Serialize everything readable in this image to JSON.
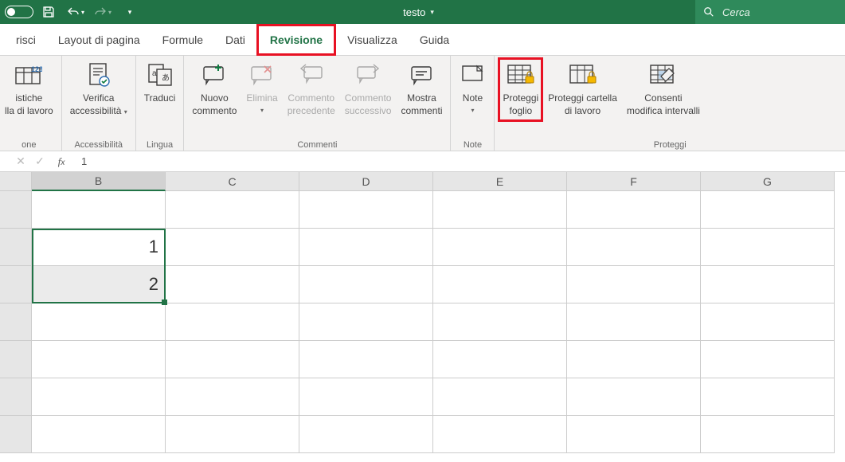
{
  "title": "testo",
  "search": {
    "placeholder": "Cerca"
  },
  "tabs": [
    "risci",
    "Layout di pagina",
    "Formule",
    "Dati",
    "Revisione",
    "Visualizza",
    "Guida"
  ],
  "active_tab": "Revisione",
  "highlighted_tab": "Revisione",
  "ribbon": {
    "groups": [
      {
        "label": "one",
        "items": [
          {
            "name": "statistics",
            "label1": "istiche",
            "label2": "lla di lavoro",
            "disabled": false
          }
        ]
      },
      {
        "label": "Accessibilità",
        "items": [
          {
            "name": "accessibility",
            "label1": "Verifica",
            "label2": "accessibilità",
            "dropdown": true
          }
        ]
      },
      {
        "label": "Lingua",
        "items": [
          {
            "name": "translate",
            "label1": "Traduci",
            "label2": ""
          }
        ]
      },
      {
        "label": "Commenti",
        "items": [
          {
            "name": "new-comment",
            "label1": "Nuovo",
            "label2": "commento"
          },
          {
            "name": "delete-comment",
            "label1": "Elimina",
            "label2": "",
            "disabled": true,
            "dropdown": true
          },
          {
            "name": "prev-comment",
            "label1": "Commento",
            "label2": "precedente",
            "disabled": true
          },
          {
            "name": "next-comment",
            "label1": "Commento",
            "label2": "successivo",
            "disabled": true
          },
          {
            "name": "show-comments",
            "label1": "Mostra",
            "label2": "commenti"
          }
        ]
      },
      {
        "label": "Note",
        "items": [
          {
            "name": "notes",
            "label1": "Note",
            "label2": "",
            "dropdown": true
          }
        ]
      },
      {
        "label": "Proteggi",
        "items": [
          {
            "name": "protect-sheet",
            "label1": "Proteggi",
            "label2": "foglio",
            "highlighted": true
          },
          {
            "name": "protect-workbook",
            "label1": "Proteggi cartella",
            "label2": "di lavoro"
          },
          {
            "name": "allow-edit-ranges",
            "label1": "Consenti",
            "label2": "modifica intervalli"
          }
        ]
      }
    ]
  },
  "formula_bar": {
    "value": "1"
  },
  "sheet": {
    "columns": [
      "B",
      "C",
      "D",
      "E",
      "F",
      "G"
    ],
    "selected_column": "B",
    "rows": [
      {
        "cells": [
          "",
          "",
          "",
          "",
          "",
          ""
        ]
      },
      {
        "cells": [
          "1",
          "",
          "",
          "",
          "",
          ""
        ]
      },
      {
        "cells": [
          "2",
          "",
          "",
          "",
          "",
          ""
        ]
      },
      {
        "cells": [
          "",
          "",
          "",
          "",
          "",
          ""
        ]
      },
      {
        "cells": [
          "",
          "",
          "",
          "",
          "",
          ""
        ]
      },
      {
        "cells": [
          "",
          "",
          "",
          "",
          "",
          ""
        ]
      },
      {
        "cells": [
          "",
          "",
          "",
          "",
          "",
          ""
        ]
      }
    ],
    "selection": {
      "col": "B",
      "row_start": 2,
      "row_end": 3
    }
  }
}
